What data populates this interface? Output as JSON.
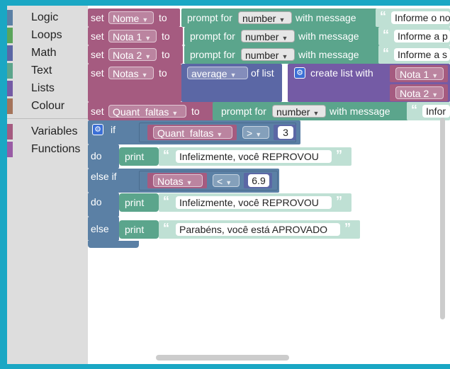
{
  "toolbox": {
    "categories": [
      {
        "label": "Logic",
        "color": "#5b80a5"
      },
      {
        "label": "Loops",
        "color": "#5ba55b"
      },
      {
        "label": "Math",
        "color": "#5b67a5"
      },
      {
        "label": "Text",
        "color": "#5ba58c"
      },
      {
        "label": "Lists",
        "color": "#745ba5"
      },
      {
        "label": "Colour",
        "color": "#a5745b"
      },
      {
        "label": "Variables",
        "color": "#a55b80"
      },
      {
        "label": "Functions",
        "color": "#995ba5"
      }
    ]
  },
  "colors": {
    "variables": "#a55b80",
    "text": "#5ba58c",
    "logic": "#5b80a5",
    "math": "#5b67a5",
    "lists": "#745ba5",
    "background": "#1aa7c4"
  },
  "blocks": {
    "set_kw": "set",
    "to_kw": "to",
    "prompt_kw": "prompt for",
    "with_message_kw": "with message",
    "number_opt": "number",
    "set1": {
      "var": "Nome",
      "message": "Informe o no"
    },
    "set2": {
      "var": "Nota 1",
      "message": "Informe a p"
    },
    "set3": {
      "var": "Nota 2",
      "message": "Informe a s"
    },
    "set4": {
      "var": "Notas",
      "func": "average",
      "of_list": "of list",
      "create_list": "create list with",
      "item1": "Nota 1",
      "item2": "Nota 2"
    },
    "set5": {
      "var": "Quant_faltas",
      "message": "Infor"
    },
    "if_block": {
      "if_kw": "if",
      "do_kw": "do",
      "else_if_kw": "else if",
      "else_kw": "else",
      "print_kw": "print",
      "cond1": {
        "var": "Quant_faltas",
        "op": ">",
        "value": "3"
      },
      "print1": "Infelizmente, você REPROVOU",
      "cond2": {
        "var": "Notas",
        "op": "<",
        "value": "6.9"
      },
      "print2": "Infelizmente, você REPROVOU",
      "print3": "Parabéns, você está APROVADO"
    }
  }
}
